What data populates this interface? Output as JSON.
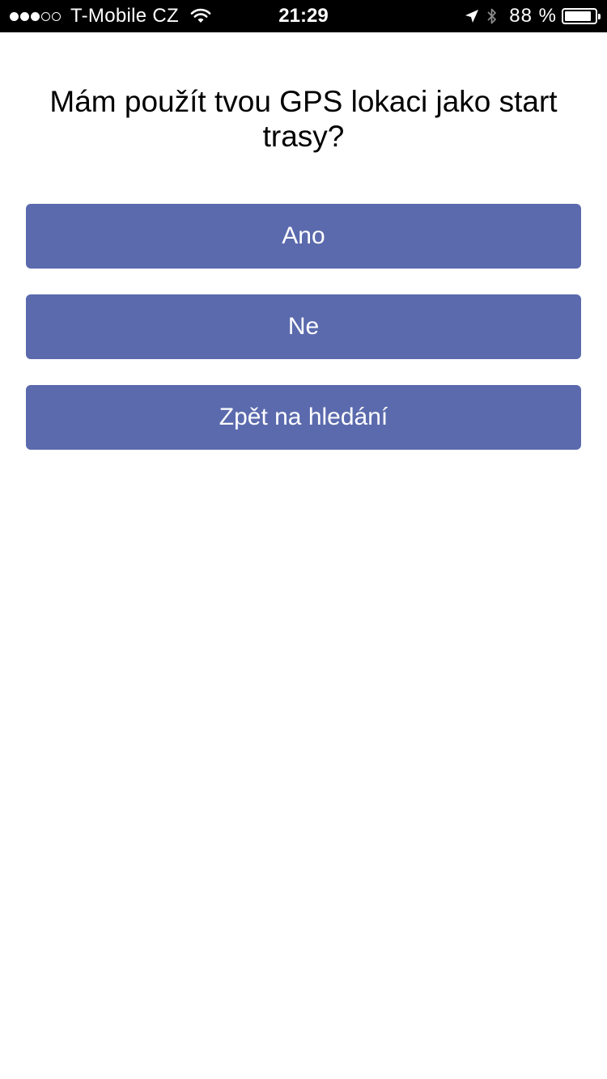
{
  "status_bar": {
    "carrier": "T-Mobile CZ",
    "signal_bars_filled": 3,
    "signal_bars_total": 5,
    "time": "21:29",
    "battery_percent_text": "88 %",
    "battery_level": 0.88,
    "icons": [
      "wifi-icon",
      "location-arrow-icon",
      "bluetooth-icon",
      "battery-icon"
    ]
  },
  "dialog": {
    "question": "Mám použít tvou GPS lokaci jako start trasy?",
    "buttons": {
      "yes": "Ano",
      "no": "Ne",
      "back": "Zpět na hledání"
    }
  },
  "colors": {
    "button_background": "#5b6aad",
    "button_text": "#ffffff",
    "status_bar_background": "#000000",
    "page_background": "#ffffff"
  }
}
